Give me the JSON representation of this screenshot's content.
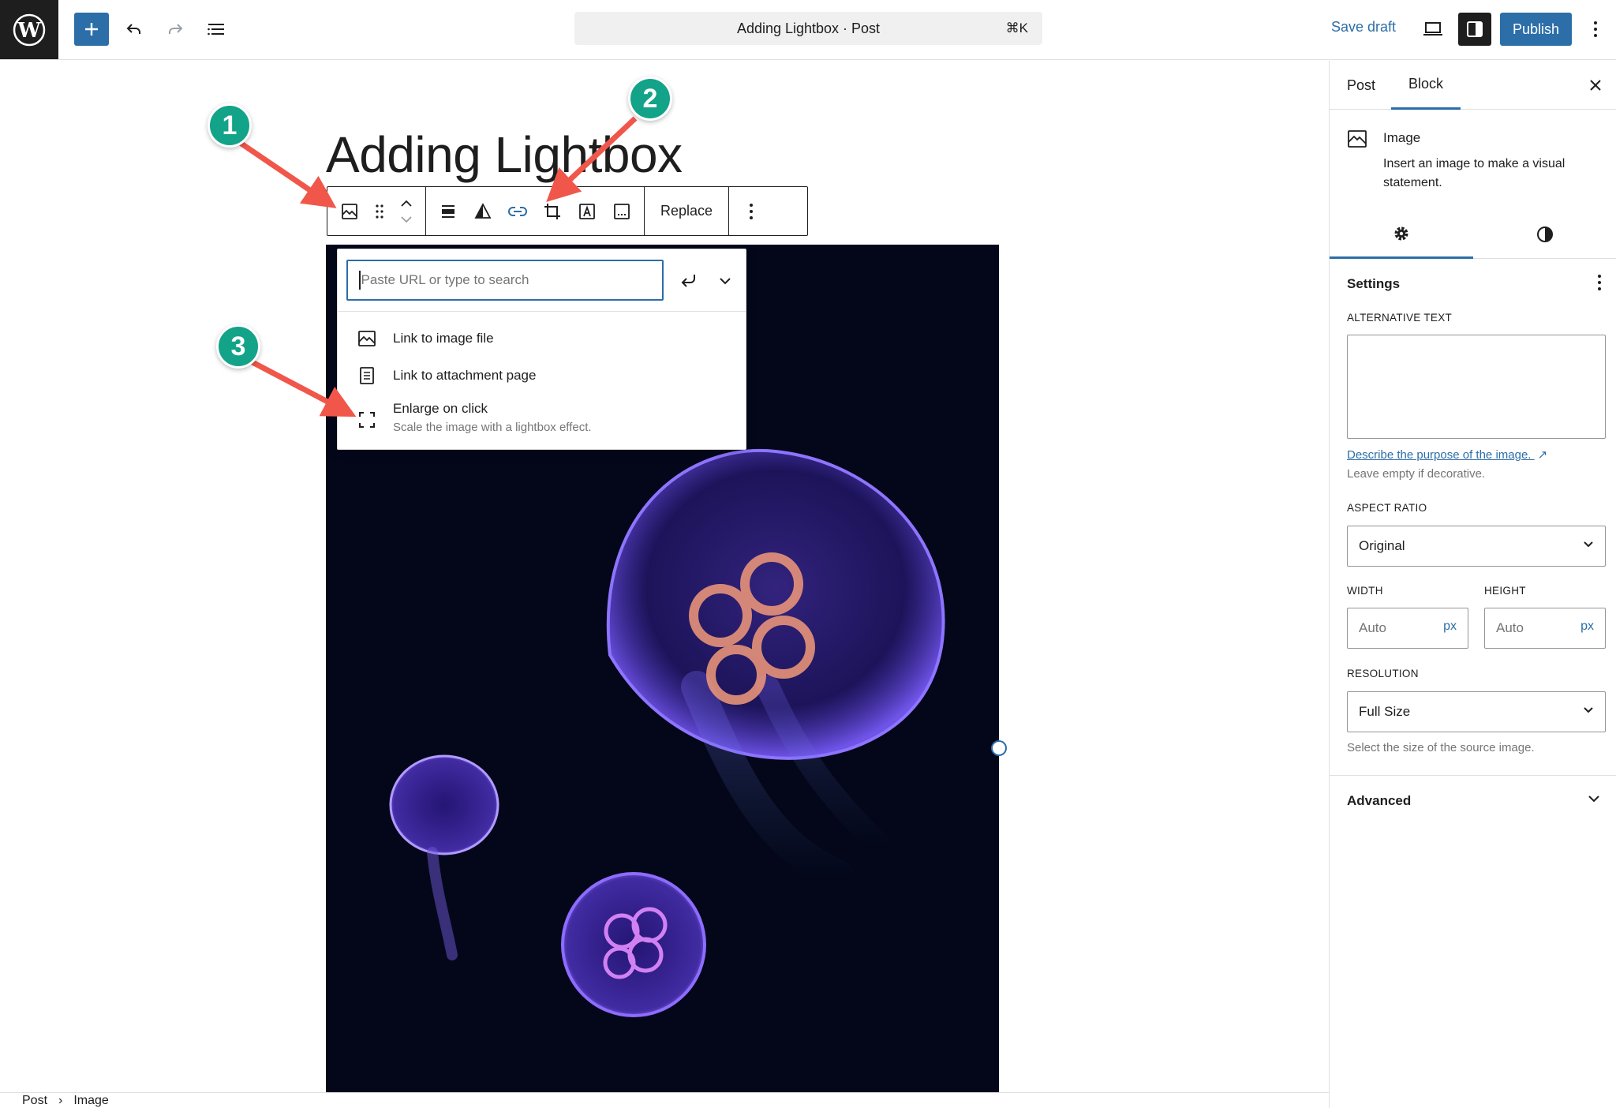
{
  "toolbar": {
    "inserter_label": "+",
    "document_title": "Adding Lightbox · Post",
    "command_shortcut": "⌘K",
    "save_draft": "Save draft",
    "publish": "Publish",
    "accent_color": "#2c6ea8"
  },
  "editor": {
    "post_title": "Adding Lightbox",
    "block_toolbar": {
      "replace_label": "Replace"
    },
    "link_popover": {
      "placeholder": "Paste URL or type to search",
      "items": [
        {
          "label": "Link to image file",
          "icon": "image-icon"
        },
        {
          "label": "Link to attachment page",
          "icon": "page-icon"
        },
        {
          "label": "Enlarge on click",
          "description": "Scale the image with a lightbox effect.",
          "icon": "fullscreen-icon"
        }
      ]
    },
    "markers": [
      "1",
      "2",
      "3"
    ],
    "marker_color": "#12a389",
    "arrow_color": "#f0574a"
  },
  "breadcrumb": [
    "Post",
    "Image"
  ],
  "sidebar": {
    "tabs": [
      "Post",
      "Block"
    ],
    "active_tab": "Block",
    "block_card": {
      "title": "Image",
      "description": "Insert an image to make a visual statement."
    },
    "panel_title": "Settings",
    "alt_text": {
      "label": "ALTERNATIVE TEXT",
      "link": "Describe the purpose of the image.",
      "link_suffix": "↗",
      "help": "Leave empty if decorative."
    },
    "aspect_ratio": {
      "label": "ASPECT RATIO",
      "value": "Original"
    },
    "width": {
      "label": "WIDTH",
      "placeholder": "Auto",
      "unit": "px"
    },
    "height": {
      "label": "HEIGHT",
      "placeholder": "Auto",
      "unit": "px"
    },
    "resolution": {
      "label": "RESOLUTION",
      "value": "Full Size",
      "help": "Select the size of the source image."
    },
    "advanced": "Advanced"
  }
}
